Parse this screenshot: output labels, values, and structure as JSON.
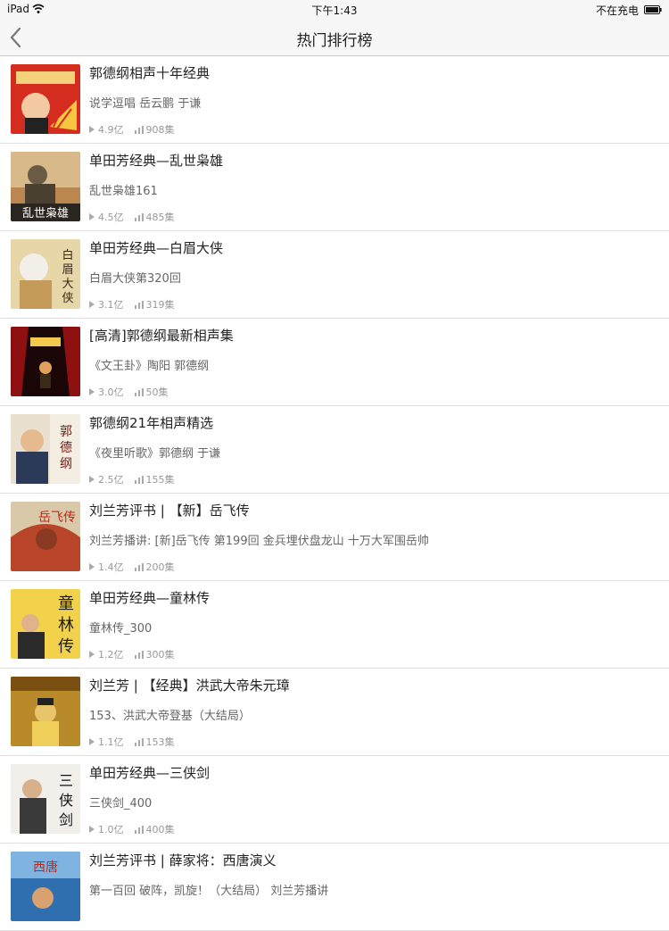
{
  "status_bar": {
    "carrier": "iPad",
    "time": "下午1:43",
    "charging": "不在充电"
  },
  "nav": {
    "title": "热门排行榜"
  },
  "colors": {
    "accent_red": "#c8281e",
    "nav_bg": "#f7f7f7",
    "meta_gray": "#999999"
  },
  "items": [
    {
      "title": "郭德纲相声十年经典",
      "subtitle": "说学逗唱 岳云鹏 于谦",
      "plays": "4.9亿",
      "episodes": "908集",
      "cover": "guo-degang-cover"
    },
    {
      "title": "单田芳经典—乱世枭雄",
      "subtitle": "乱世枭雄161",
      "plays": "4.5亿",
      "episodes": "485集",
      "cover": "luanshi-cover"
    },
    {
      "title": "单田芳经典—白眉大侠",
      "subtitle": "白眉大侠第320回",
      "plays": "3.1亿",
      "episodes": "319集",
      "cover": "baimei-cover"
    },
    {
      "title": "[高清]郭德纲最新相声集",
      "subtitle": "《文王卦》陶阳 郭德纲",
      "plays": "3.0亿",
      "episodes": "50集",
      "cover": "stage-cover"
    },
    {
      "title": "郭德纲21年相声精选",
      "subtitle": "《夜里听歌》郭德纲 于谦",
      "plays": "2.5亿",
      "episodes": "155集",
      "cover": "guo-21-cover"
    },
    {
      "title": "刘兰芳评书 | 【新】岳飞传",
      "subtitle": "刘兰芳播讲: [新]岳飞传 第199回 金兵埋伏盘龙山 十万大军围岳帅",
      "plays": "1.4亿",
      "episodes": "200集",
      "cover": "yuefei-cover"
    },
    {
      "title": "单田芳经典—童林传",
      "subtitle": "童林传_300",
      "plays": "1.2亿",
      "episodes": "300集",
      "cover": "tonglin-cover"
    },
    {
      "title": "刘兰芳 | 【经典】洪武大帝朱元璋",
      "subtitle": "153、洪武大帝登基（大结局）",
      "plays": "1.1亿",
      "episodes": "153集",
      "cover": "hongwu-cover"
    },
    {
      "title": "单田芳经典—三侠剑",
      "subtitle": "三侠剑_400",
      "plays": "1.0亿",
      "episodes": "400集",
      "cover": "sanxia-cover"
    },
    {
      "title": "刘兰芳评书 | 薛家将：西唐演义",
      "subtitle": "第一百回 破阵，凯旋！（大结局） 刘兰芳播讲",
      "plays": "",
      "episodes": "",
      "cover": "xitang-cover"
    }
  ]
}
